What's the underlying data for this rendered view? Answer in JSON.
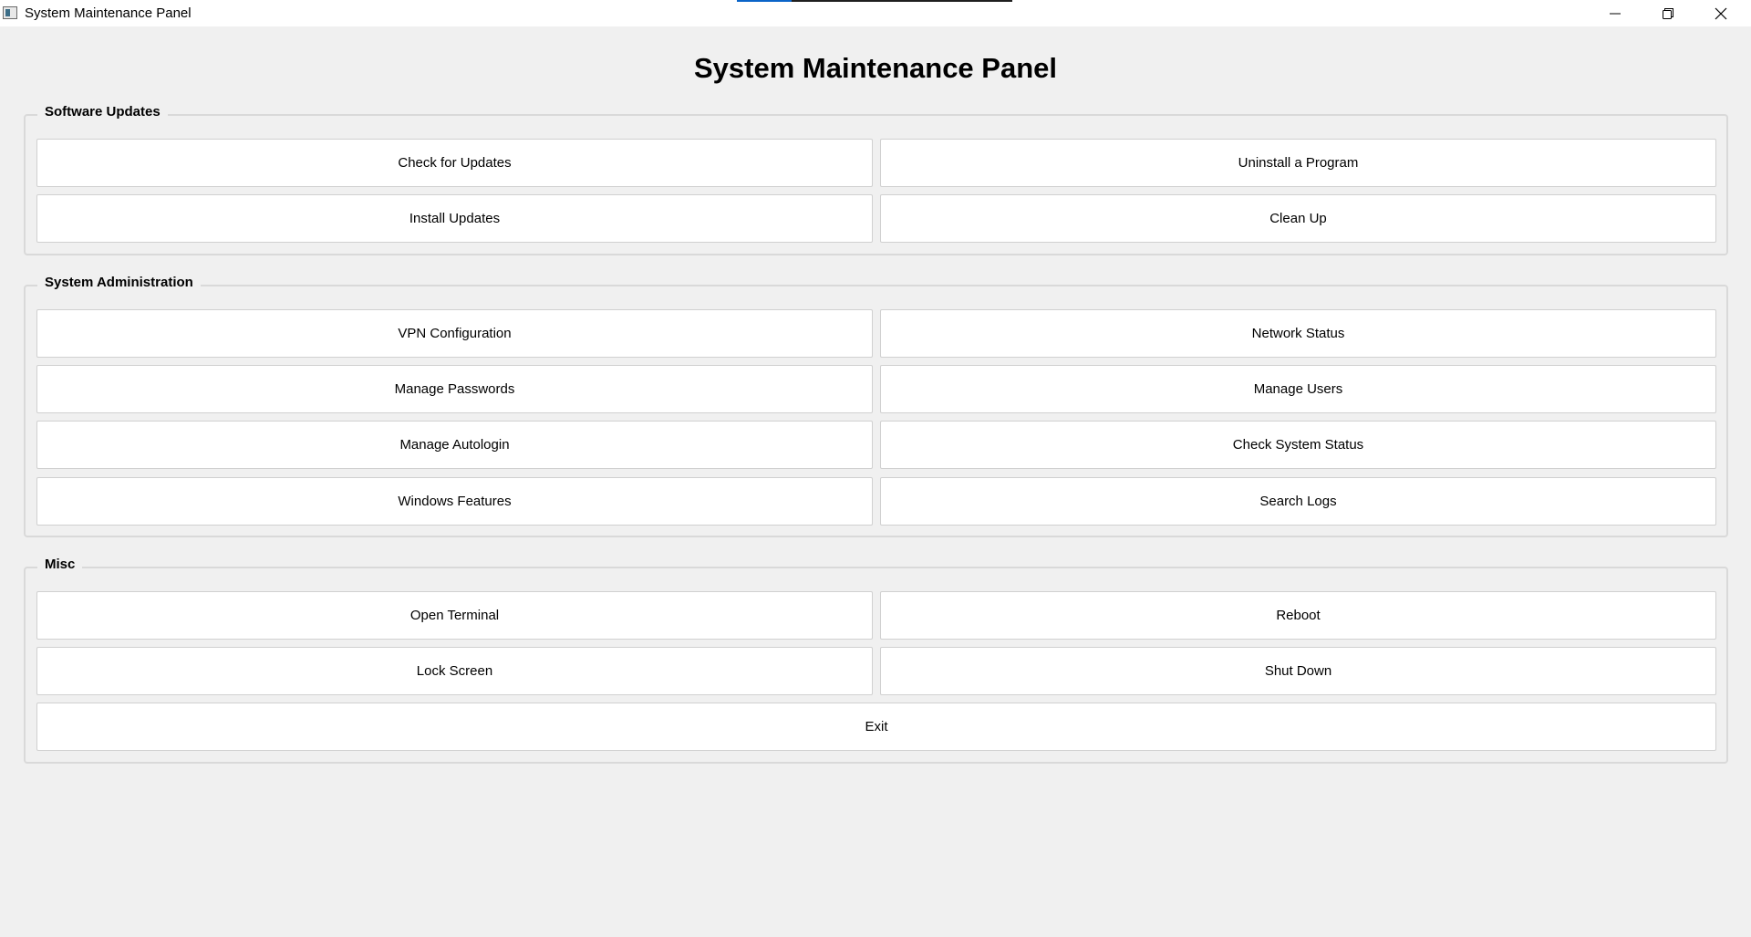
{
  "window": {
    "title": "System Maintenance Panel",
    "title_progress_fraction": 0.2
  },
  "header": {
    "title": "System Maintenance Panel"
  },
  "groups": {
    "software_updates": {
      "label": "Software Updates",
      "buttons": {
        "check_updates": "Check for Updates",
        "uninstall_program": "Uninstall a Program",
        "install_updates": "Install Updates",
        "clean_up": "Clean Up"
      }
    },
    "system_administration": {
      "label": "System Administration",
      "buttons": {
        "vpn_configuration": "VPN Configuration",
        "network_status": "Network Status",
        "manage_passwords": "Manage Passwords",
        "manage_users": "Manage Users",
        "manage_autologin": "Manage Autologin",
        "check_system_status": "Check System Status",
        "windows_features": "Windows Features",
        "search_logs": "Search Logs"
      }
    },
    "misc": {
      "label": "Misc",
      "buttons": {
        "open_terminal": "Open Terminal",
        "reboot": "Reboot",
        "lock_screen": "Lock Screen",
        "shut_down": "Shut Down",
        "exit": "Exit"
      }
    }
  },
  "icons": {
    "app": "app-window-icon",
    "minimize": "minimize-icon",
    "maximize": "restore-icon",
    "close": "close-icon"
  },
  "colors": {
    "background": "#f0f0f0",
    "button_face": "#ffffff",
    "button_border": "#d0d0d0",
    "group_border": "#d9d9d9",
    "progress_fill": "#0a64c8"
  }
}
